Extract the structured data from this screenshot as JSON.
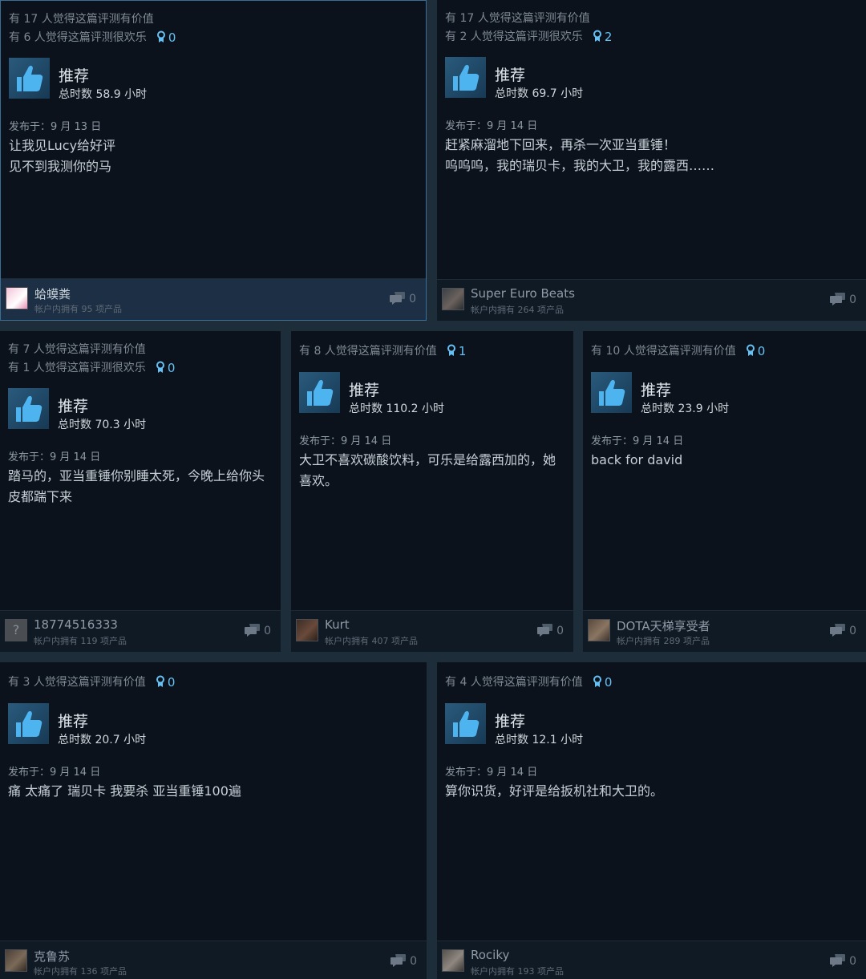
{
  "reviews": [
    {
      "helpful": "有 17 人觉得这篇评测有价值",
      "funny": "有 6 人觉得这篇评测很欢乐",
      "awards": "0",
      "title": "推荐",
      "hours": "总时数 58.9 小时",
      "posted": "发布于：9 月 13 日",
      "body": [
        "让我见Lucy给好评",
        "见不到我测你的马"
      ],
      "user": "蛤蟆粪",
      "owned": "帐户内拥有 95 项产品",
      "comments": "0"
    },
    {
      "helpful": "有 17 人觉得这篇评测有价值",
      "funny": "有 2 人觉得这篇评测很欢乐",
      "awards": "2",
      "title": "推荐",
      "hours": "总时数 69.7 小时",
      "posted": "发布于：9 月 14 日",
      "body": [
        "赶紧麻溜地下回来，再杀一次亚当重锤！",
        "呜呜呜，我的瑞贝卡，我的大卫，我的露西……"
      ],
      "user": "Super Euro Beats",
      "owned": "帐户内拥有 264 项产品",
      "comments": "0"
    },
    {
      "helpful": "有 7 人觉得这篇评测有价值",
      "funny": "有 1 人觉得这篇评测很欢乐",
      "awards": "0",
      "title": "推荐",
      "hours": "总时数 70.3 小时",
      "posted": "发布于：9 月 14 日",
      "body": [
        "踏马的，亚当重锤你别睡太死，今晚上给你头",
        "皮都踹下来"
      ],
      "user": "18774516333",
      "owned": "帐户内拥有 119 项产品",
      "comments": "0"
    },
    {
      "helpful": "有 8 人觉得这篇评测有价值",
      "awards": "1",
      "title": "推荐",
      "hours": "总时数 110.2 小时",
      "posted": "发布于：9 月 14 日",
      "body": [
        "大卫不喜欢碳酸饮料，可乐是给露西加的，她",
        "喜欢。"
      ],
      "user": "Kurt",
      "owned": "帐户内拥有 407 项产品",
      "comments": "0"
    },
    {
      "helpful": "有 10 人觉得这篇评测有价值",
      "awards": "0",
      "title": "推荐",
      "hours": "总时数 23.9 小时",
      "posted": "发布于：9 月 14 日",
      "body": [
        "back for david"
      ],
      "user": "DOTA天梯享受者",
      "owned": "帐户内拥有 289 项产品",
      "comments": "0"
    },
    {
      "helpful": "有 3 人觉得这篇评测有价值",
      "awards": "0",
      "title": "推荐",
      "hours": "总时数 20.7 小时",
      "posted": "发布于：9 月 14 日",
      "body": [
        "痛 太痛了 瑞贝卡 我要杀 亚当重锤100遍"
      ],
      "user": "克鲁苏",
      "owned": "帐户内拥有 136 项产品",
      "comments": "0"
    },
    {
      "helpful": "有 4 人觉得这篇评测有价值",
      "awards": "0",
      "title": "推荐",
      "hours": "总时数 12.1 小时",
      "posted": "发布于：9 月 14 日",
      "body": [
        "算你识货，好评是给扳机社和大卫的。"
      ],
      "user": "Rociky",
      "owned": "帐户内拥有 193 项产品",
      "comments": "0"
    }
  ],
  "colors": {
    "accent": "#66c0f4",
    "card_bg": "#0b121b",
    "page_bg": "#1d2d3a"
  },
  "icons": {
    "thumb": "thumbs-up-icon",
    "award": "award-icon",
    "comment": "comment-bubble-icon"
  }
}
